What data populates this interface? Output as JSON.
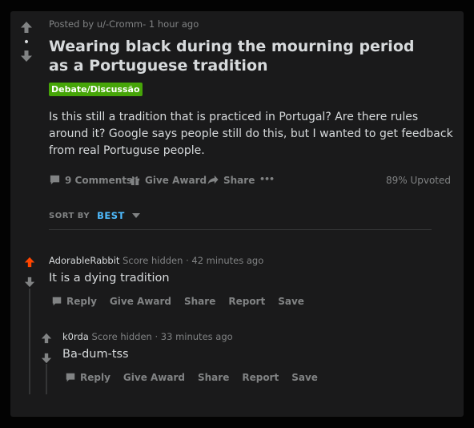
{
  "post": {
    "meta": "Posted by u/-Cromm- 1 hour ago",
    "title": "Wearing black during the mourning period as a Portuguese tradition",
    "flair": "Debate/Discussão",
    "flair_color": "#46a508",
    "body": "Is this still a tradition that is practiced in Portugal? Are there rules around it? Google says people still do this, but I wanted to get feedback from real Portuguse people.",
    "vote_indicator": "•",
    "actions": {
      "comments": "9 Comments",
      "give_award": "Give Award",
      "share": "Share",
      "more": "•••",
      "upvoted": "89% Upvoted"
    }
  },
  "sort": {
    "label": "SORT BY",
    "value": "BEST",
    "accent": "#4fbcff"
  },
  "comments": [
    {
      "author": "AdorableRabbit",
      "score": "Score hidden",
      "time": "· 42 minutes ago",
      "body": "It is a dying tradition",
      "upvoted": true,
      "upvote_color": "#ff4500",
      "actions": {
        "reply": "Reply",
        "give_award": "Give Award",
        "share": "Share",
        "report": "Report",
        "save": "Save"
      }
    },
    {
      "author": "k0rda",
      "score": "Score hidden",
      "time": "· 33 minutes ago",
      "body": "Ba-dum-tss",
      "upvoted": false,
      "actions": {
        "reply": "Reply",
        "give_award": "Give Award",
        "share": "Share",
        "report": "Report",
        "save": "Save"
      }
    }
  ]
}
